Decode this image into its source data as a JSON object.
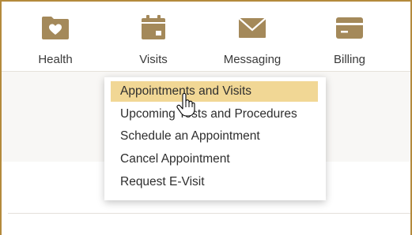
{
  "nav": {
    "items": [
      {
        "label": "Health",
        "icon": "folder-heart-icon"
      },
      {
        "label": "Visits",
        "icon": "calendar-icon"
      },
      {
        "label": "Messaging",
        "icon": "envelope-icon"
      },
      {
        "label": "Billing",
        "icon": "credit-card-icon"
      }
    ]
  },
  "dropdown": {
    "items": [
      {
        "label": "Appointments and Visits"
      },
      {
        "label": "Upcoming Tests and Procedures"
      },
      {
        "label": "Schedule an Appointment"
      },
      {
        "label": "Cancel Appointment"
      },
      {
        "label": "Request E-Visit"
      }
    ],
    "highlighted": "Appointments and Visits"
  },
  "colors": {
    "accent": "#a4895a",
    "frame_border": "#b48a3c",
    "highlight": "#f1d795",
    "text": "#3a3a3a"
  }
}
